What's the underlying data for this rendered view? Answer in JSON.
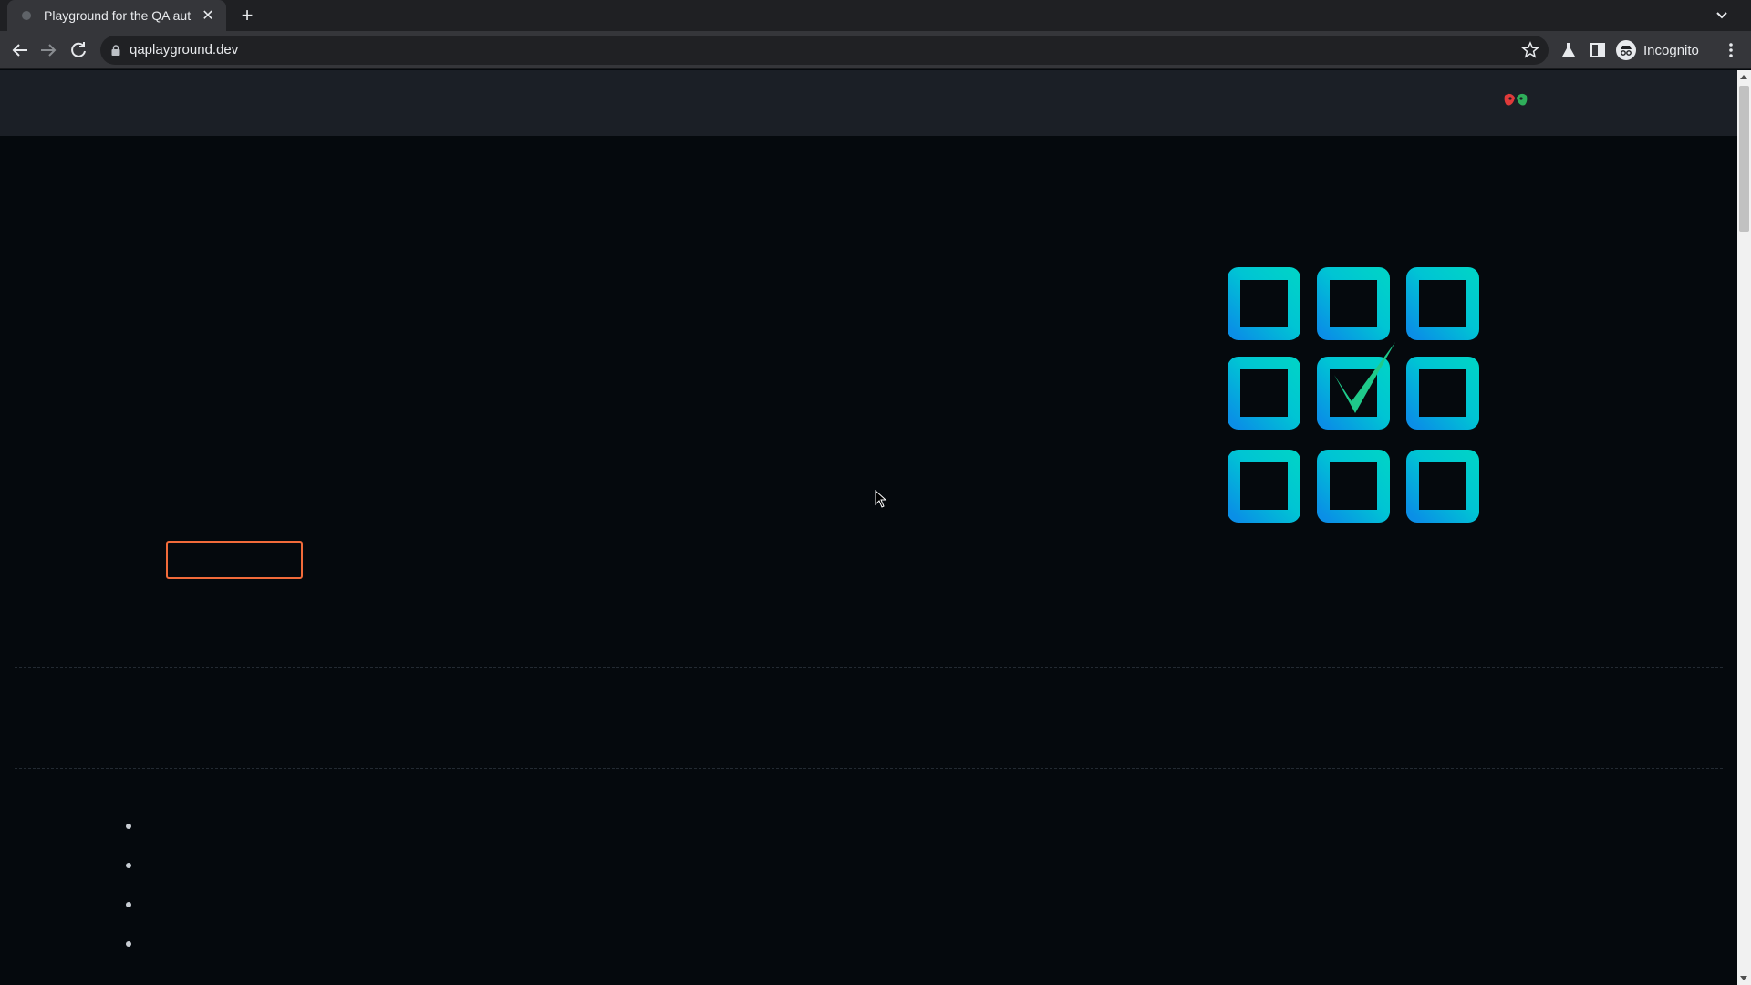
{
  "browser": {
    "tab": {
      "title": "Playground for the QA aut",
      "close_icon": "close-icon"
    },
    "new_tab_icon": "plus-icon",
    "address_bar": {
      "url": "qaplayground.dev",
      "lock_icon": "lock-icon"
    },
    "profile": {
      "label": "Incognito",
      "icon": "incognito-icon"
    }
  },
  "page": {
    "header_logo": "mask-logo",
    "hero_graphic": {
      "icon": "checkbox-grid-icon",
      "tile_color": "#00c4d4",
      "check_color": "#1fc98a"
    },
    "cta_button": {
      "label": "",
      "border_color": "#f26b3a"
    },
    "list_items": [
      "",
      "",
      "",
      ""
    ]
  }
}
